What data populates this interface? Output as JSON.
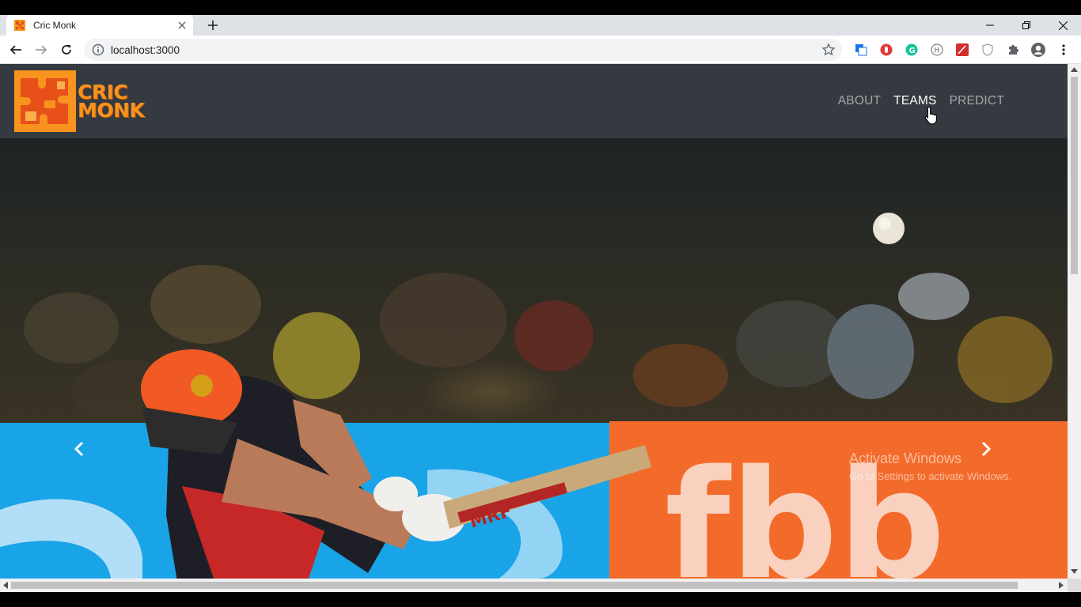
{
  "browser": {
    "tab_title": "Cric Monk",
    "url": "localhost:3000"
  },
  "site": {
    "logo_line1": "CRIC",
    "logo_line2": "MONK",
    "nav": [
      {
        "label": "ABOUT",
        "active": false
      },
      {
        "label": "TEAMS",
        "active": true
      },
      {
        "label": "PREDICT",
        "active": false
      }
    ]
  },
  "hero": {
    "image_subject": "cricket batsman playing a shot with MRF bat",
    "bat_brand": "MRF",
    "banner_text": "fbb"
  },
  "watermark": {
    "title": "Activate Windows",
    "subtitle": "Go to Settings to activate Windows."
  },
  "colors": {
    "navbar_bg": "#343a40",
    "logo_orange": "#f7931e",
    "tabstrip_bg": "#dee1e6"
  }
}
